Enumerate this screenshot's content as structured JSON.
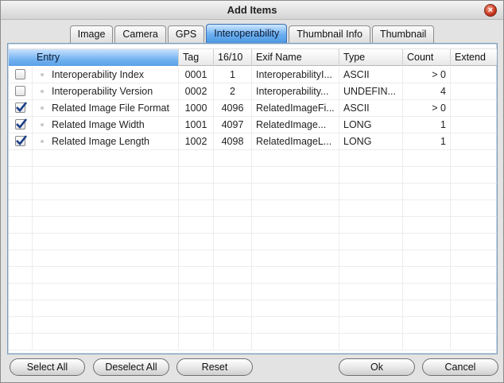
{
  "window": {
    "title": "Add Items",
    "close_glyph": "×"
  },
  "tabs": [
    {
      "label": "Image",
      "active": false
    },
    {
      "label": "Camera",
      "active": false
    },
    {
      "label": "GPS",
      "active": false
    },
    {
      "label": "Interoperability",
      "active": true
    },
    {
      "label": "Thumbnail Info",
      "active": false
    },
    {
      "label": "Thumbnail",
      "active": false
    }
  ],
  "table": {
    "columns": {
      "entry": "Entry",
      "tag": "Tag",
      "dec": "16/10",
      "exif_name": "Exif Name",
      "type": "Type",
      "count": "Count",
      "extend": "Extend"
    },
    "rows": [
      {
        "checked": false,
        "entry": "Interoperability Index",
        "tag": "0001",
        "dec": "1",
        "exif_name": "InteroperabilityI...",
        "type": "ASCII",
        "count": "> 0",
        "extend": ""
      },
      {
        "checked": false,
        "entry": "Interoperability Version",
        "tag": "0002",
        "dec": "2",
        "exif_name": "Interoperability...",
        "type": "UNDEFIN...",
        "count": "4",
        "extend": ""
      },
      {
        "checked": true,
        "entry": "Related Image File Format",
        "tag": "1000",
        "dec": "4096",
        "exif_name": "RelatedImageFi...",
        "type": "ASCII",
        "count": "> 0",
        "extend": ""
      },
      {
        "checked": true,
        "entry": "Related Image Width",
        "tag": "1001",
        "dec": "4097",
        "exif_name": "RelatedImage...",
        "type": "LONG",
        "count": "1",
        "extend": ""
      },
      {
        "checked": true,
        "entry": "Related Image Length",
        "tag": "1002",
        "dec": "4098",
        "exif_name": "RelatedImageL...",
        "type": "LONG",
        "count": "1",
        "extend": ""
      }
    ]
  },
  "buttons": {
    "select_all": "Select All",
    "deselect_all": "Deselect All",
    "reset": "Reset",
    "ok": "Ok",
    "cancel": "Cancel"
  },
  "colors": {
    "active_tab": "#6aaef0",
    "checkmark": "#1b3e8a",
    "close_button": "#c8341d"
  },
  "icons": {
    "close": "close-icon",
    "check": "checkmark-icon",
    "bullet": "bullet-icon"
  }
}
